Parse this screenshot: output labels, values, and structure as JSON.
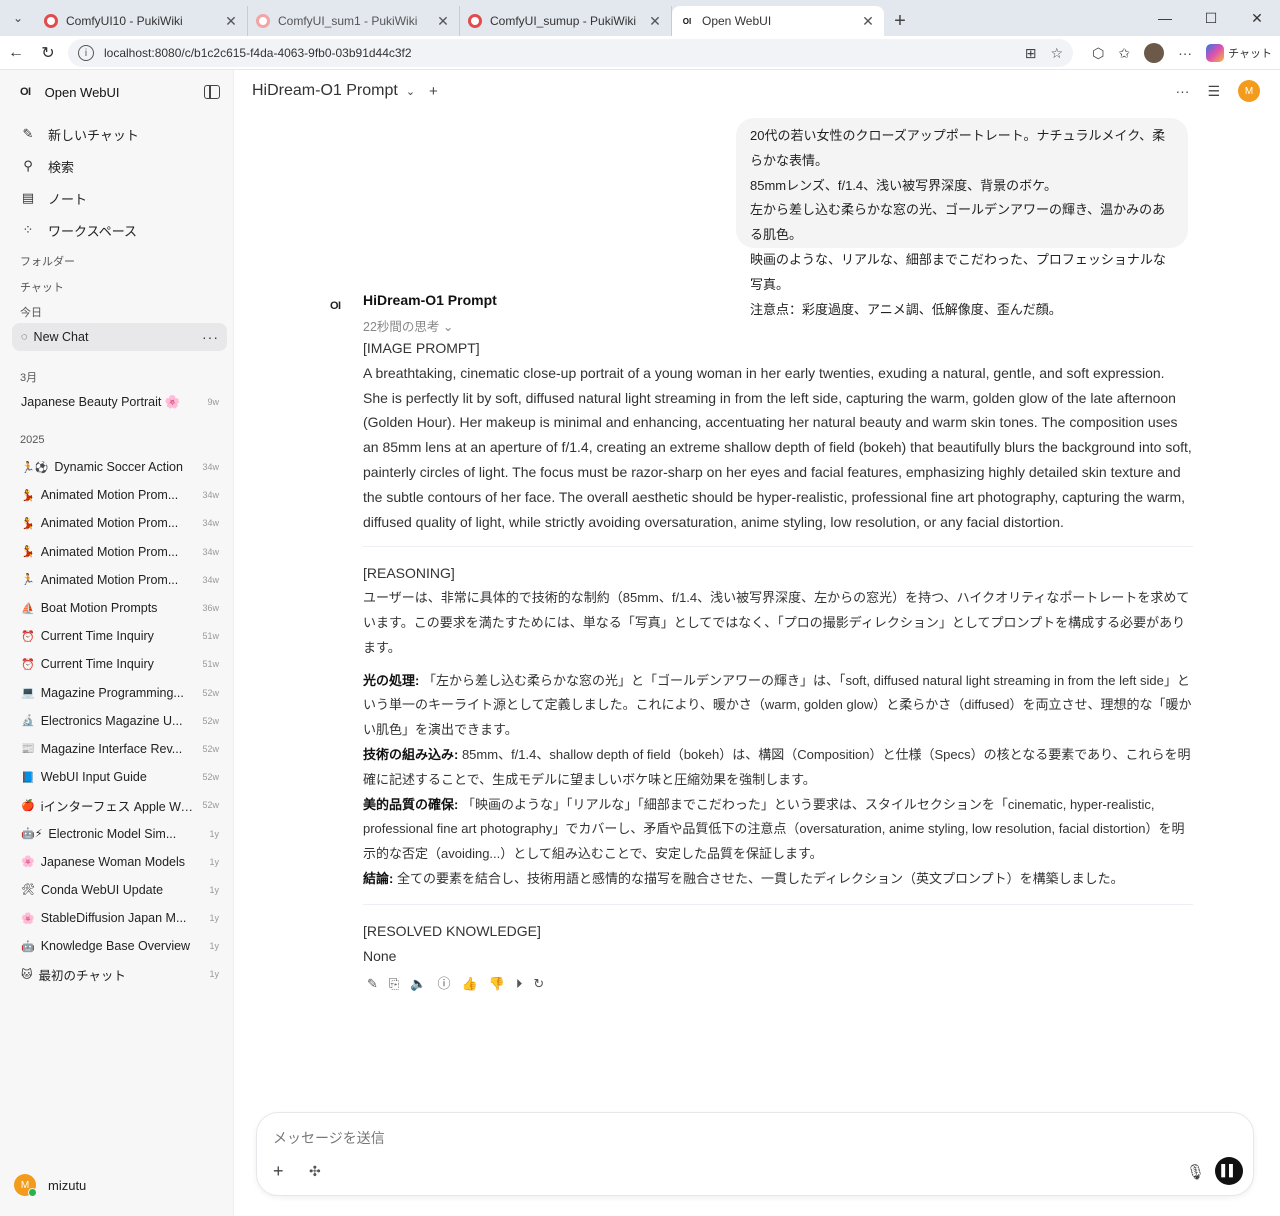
{
  "browser": {
    "tabs": [
      {
        "title": "ComfyUI10 - PukiWiki",
        "icon": "pukiwiki-icon"
      },
      {
        "title": "ComfyUI_sum1 - PukiWiki",
        "icon": "pukiwiki-icon"
      },
      {
        "title": "ComfyUI_sumup - PukiWiki",
        "icon": "pukiwiki-icon"
      },
      {
        "title": "Open WebUI",
        "icon": "openwebui-icon"
      }
    ],
    "url": "localhost:8080/c/b1c2c615-f4da-4063-9fb0-03b91d44c3f2",
    "copilot_label": "チャット"
  },
  "sidebar": {
    "app_name": "Open WebUI",
    "logo": "OI",
    "menu": [
      {
        "label": "新しいチャット",
        "icon": "edit-icon"
      },
      {
        "label": "検索",
        "icon": "search-icon"
      },
      {
        "label": "ノート",
        "icon": "note-icon"
      },
      {
        "label": "ワークスペース",
        "icon": "workspace-icon"
      }
    ],
    "folders_label": "フォルダー",
    "chats_label": "チャット",
    "today_label": "今日",
    "today_chats": [
      {
        "title": "New Chat",
        "emoji": "◌"
      }
    ],
    "march_label": "3月",
    "march_chats": [
      {
        "title": "Japanese Beauty Portrait 🌸",
        "age": "9w"
      }
    ],
    "year_label": "2025",
    "year_chats": [
      {
        "emoji": "🏃⚽",
        "title": "Dynamic Soccer Action",
        "age": "34w"
      },
      {
        "emoji": "💃",
        "title": "Animated Motion Prom...",
        "age": "34w"
      },
      {
        "emoji": "💃",
        "title": "Animated Motion Prom...",
        "age": "34w"
      },
      {
        "emoji": "💃",
        "title": "Animated Motion Prom...",
        "age": "34w"
      },
      {
        "emoji": "🏃",
        "title": "Animated Motion Prom...",
        "age": "34w"
      },
      {
        "emoji": "⛵",
        "title": "Boat Motion Prompts",
        "age": "36w"
      },
      {
        "emoji": "⏰",
        "title": "Current Time Inquiry",
        "age": "51w"
      },
      {
        "emoji": "⏰",
        "title": "Current Time Inquiry",
        "age": "51w"
      },
      {
        "emoji": "💻",
        "title": "Magazine Programming...",
        "age": "52w"
      },
      {
        "emoji": "🔬",
        "title": "Electronics Magazine U...",
        "age": "52w"
      },
      {
        "emoji": "📰",
        "title": "Magazine Interface Rev...",
        "age": "52w"
      },
      {
        "emoji": "📘",
        "title": "WebUI Input Guide",
        "age": "52w"
      },
      {
        "emoji": "🍎",
        "title": "iインターフェス Apple Watch",
        "age": "52w"
      },
      {
        "emoji": "🤖⚡",
        "title": "Electronic Model Sim...",
        "age": "1y"
      },
      {
        "emoji": "🌸",
        "title": "Japanese Woman Models",
        "age": "1y"
      },
      {
        "emoji": "🛠",
        "title": "Conda WebUI Update",
        "age": "1y"
      },
      {
        "emoji": "🌸",
        "title": "StableDiffusion Japan M...",
        "age": "1y"
      },
      {
        "emoji": "🤖",
        "title": "Knowledge Base Overview",
        "age": "1y"
      },
      {
        "emoji": "🐱",
        "title": "最初のチャット",
        "age": "1y"
      }
    ],
    "user": {
      "initial": "M",
      "name": "mizutu"
    }
  },
  "main": {
    "model_title": "HiDream-O1 Prompt",
    "user_avatar_initial": "M",
    "user_message": [
      "20代の若い女性のクローズアップポートレート。ナチュラルメイク、柔らかな表情。",
      "85mmレンズ、f/1.4、浅い被写界深度、背景のボケ。",
      "左から差し込む柔らかな窓の光、ゴールデンアワーの輝き、温かみのある肌色。",
      "映画のような、リアルな、細部までこだわった、プロフェッショナルな写真。",
      "注意点：彩度過度、アニメ調、低解像度、歪んだ顔。"
    ],
    "assistant": {
      "name": "HiDream-O1 Prompt",
      "thinking": "22秒間の思考",
      "image_prompt_header": "[IMAGE PROMPT]",
      "image_prompt": "A breathtaking, cinematic close-up portrait of a young woman in her early twenties, exuding a natural, gentle, and soft expression. She is perfectly lit by soft, diffused natural light streaming in from the left side, capturing the warm, golden glow of the late afternoon (Golden Hour). Her makeup is minimal and enhancing, accentuating her natural beauty and warm skin tones. The composition uses an 85mm lens at an aperture of f/1.4, creating an extreme shallow depth of field (bokeh) that beautifully blurs the background into soft, painterly circles of light. The focus must be razor-sharp on her eyes and facial features, emphasizing highly detailed skin texture and the subtle contours of her face. The overall aesthetic should be hyper-realistic, professional fine art photography, capturing the warm, diffused quality of light, while strictly avoiding oversaturation, anime styling, low resolution, or any facial distortion.",
      "reasoning_header": "[REASONING]",
      "reasoning_intro": "ユーザーは、非常に具体的で技術的な制約（85mm、f/1.4、浅い被写界深度、左からの窓光）を持つ、ハイクオリティなポートレートを求めています。この要求を満たすためには、単なる「写真」としてではなく、「プロの撮影ディレクション」としてプロンプトを構成する必要があります。",
      "points": [
        {
          "label": "光の処理:",
          "text": " 「左から差し込む柔らかな窓の光」と「ゴールデンアワーの輝き」は、「soft, diffused natural light streaming in from the left side」という単一のキーライト源として定義しました。これにより、暖かさ（warm, golden glow）と柔らかさ（diffused）を両立させ、理想的な「暖かい肌色」を演出できます。"
        },
        {
          "label": "技術の組み込み:",
          "text": " 85mm、f/1.4、shallow depth of field（bokeh）は、構図（Composition）と仕様（Specs）の核となる要素であり、これらを明確に記述することで、生成モデルに望ましいボケ味と圧縮効果を強制します。"
        },
        {
          "label": "美的品質の確保:",
          "text": " 「映画のような」「リアルな」「細部までこだわった」という要求は、スタイルセクションを「cinematic, hyper-realistic, professional fine art photography」でカバーし、矛盾や品質低下の注意点（oversaturation, anime styling, low resolution, facial distortion）を明示的な否定（avoiding...）として組み込むことで、安定した品質を保証します。"
        },
        {
          "label": "結論:",
          "text": " 全ての要素を結合し、技術用語と感情的な描写を融合させた、一貫したディレクション（英文プロンプト）を構築しました。"
        }
      ],
      "knowledge_header": "[RESOLVED KNOWLEDGE]",
      "knowledge_value": "None"
    },
    "composer_placeholder": "メッセージを送信"
  }
}
